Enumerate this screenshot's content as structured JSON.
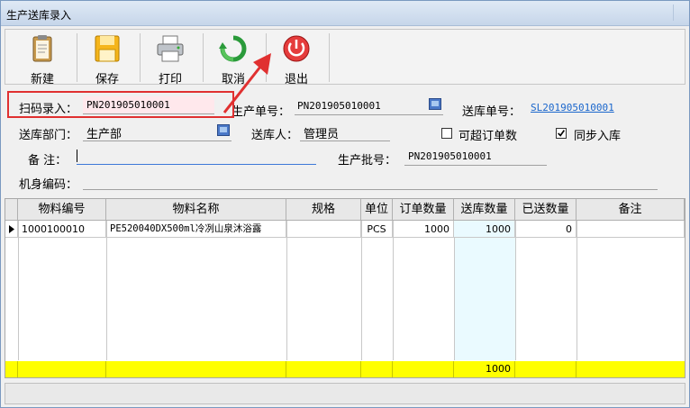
{
  "window": {
    "title": "生产送库录入"
  },
  "toolbar": {
    "buttons": [
      {
        "label": "新建",
        "icon": "clipboard-icon"
      },
      {
        "label": "保存",
        "icon": "floppy-disk-icon"
      },
      {
        "label": "打印",
        "icon": "printer-icon"
      },
      {
        "label": "取消",
        "icon": "refresh-cancel-icon"
      },
      {
        "label": "退出",
        "icon": "power-exit-icon"
      }
    ]
  },
  "form": {
    "scan_label": "扫码录入：",
    "scan_value": "PN201905010001",
    "prod_no_label": "生产单号：",
    "prod_no_value": "PN201905010001",
    "delivery_no_label": "送库单号：",
    "delivery_no_value": "SL201905010001",
    "dept_label": "送库部门：",
    "dept_value": "生产部",
    "sender_label": "送库人：",
    "sender_value": "管理员",
    "over_order_label": "可超订单数",
    "over_order_checked": false,
    "sync_label": "同步入库",
    "sync_checked": true,
    "remark_label": "备  注：",
    "remark_value": "",
    "batch_label": "生产批号：",
    "batch_value": "PN201905010001",
    "serial_label": "机身编码："
  },
  "grid": {
    "columns": [
      "物料编号",
      "物料名称",
      "规格",
      "单位",
      "订单数量",
      "送库数量",
      "已送数量",
      "备注"
    ],
    "rows": [
      [
        "1000100010",
        "PE520040DX500ml冷冽山泉沐浴露",
        "",
        "PCS",
        "1000",
        "1000",
        "0",
        ""
      ]
    ],
    "total_delivery": "1000"
  },
  "colors": {
    "highlight": "#e03030",
    "summary_row": "#ffff00",
    "link": "#1a66cc"
  }
}
